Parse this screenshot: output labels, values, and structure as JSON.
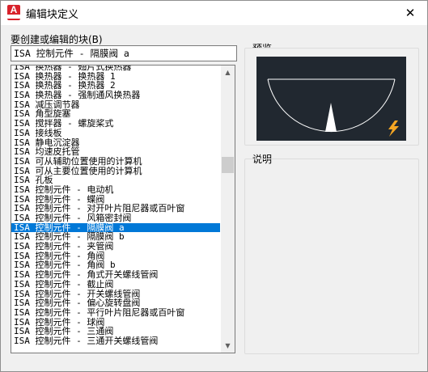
{
  "window": {
    "title": "编辑块定义",
    "app_icon_letter": "A"
  },
  "close_glyph": "✕",
  "block_list_label": "要创建或编辑的块(B)",
  "block_name_value": "ISA 控制元件 - 隔膜阀 a",
  "block_items": [
    "ISA 换热器 - 翅片式换热器",
    "ISA 换热器 - 换热器 1",
    "ISA 换热器 - 换热器 2",
    "ISA 换热器 - 强制通风换热器",
    "ISA 减压调节器",
    "ISA 角型旋塞",
    "ISA 搅拌器 - 螺旋桨式",
    "ISA 接线板",
    "ISA 静电沉淀器",
    "ISA 均速皮托管",
    "ISA 可从辅助位置使用的计算机",
    "ISA 可从主要位置使用的计算机",
    "ISA 孔板",
    "ISA 控制元件 - 电动机",
    "ISA 控制元件 - 蝶阀",
    "ISA 控制元件 - 对开叶片阻尼器或百叶窗",
    "ISA 控制元件 - 风箱密封阀",
    "ISA 控制元件 - 隔膜阀 a",
    "ISA 控制元件 - 隔膜阀 b",
    "ISA 控制元件 - 夹管阀",
    "ISA 控制元件 - 角阀",
    "ISA 控制元件 - 角阀 b",
    "ISA 控制元件 - 角式开关螺线管阀",
    "ISA 控制元件 - 截止阀",
    "ISA 控制元件 - 开关螺线管阀",
    "ISA 控制元件 - 偏心旋转盘阀",
    "ISA 控制元件 - 平行叶片阻尼器或百叶窗",
    "ISA 控制元件 - 球阀",
    "ISA 控制元件 - 三通阀",
    "ISA 控制元件 - 三通开关螺线管阀"
  ],
  "selected_index": 17,
  "preview_label": "预览",
  "description_label": "说明",
  "description_text": "",
  "colors": {
    "selection": "#0078d7",
    "preview_background": "#212830",
    "lightning": "#f5a623",
    "autocad_red": "#d8222b"
  },
  "icons": {
    "app": "autocad-app-icon",
    "close": "close-icon",
    "scroll_up": "chevron-up-icon",
    "scroll_down": "chevron-down-icon",
    "dynamic_block": "lightning-bolt-icon"
  }
}
